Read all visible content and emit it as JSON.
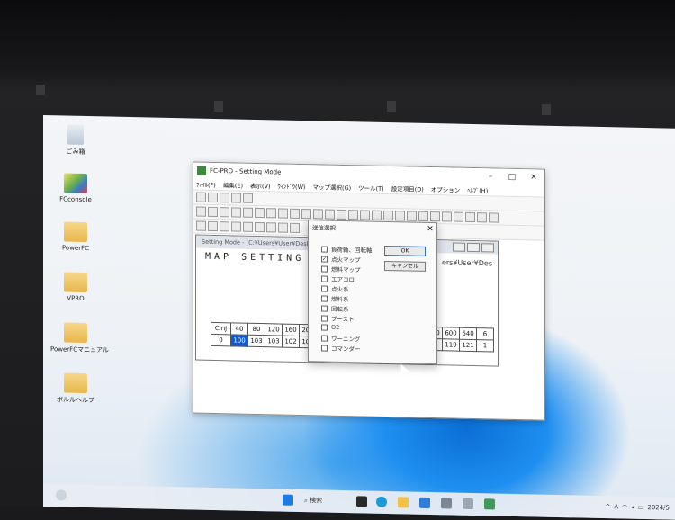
{
  "desktop": {
    "icons": [
      {
        "label": "ごみ箱",
        "kind": "bin"
      },
      {
        "label": "FCconsole",
        "kind": "app"
      },
      {
        "label": "PowerFC",
        "kind": "folder"
      },
      {
        "label": "VPRO",
        "kind": "folder"
      },
      {
        "label": "PowerFCマニュアル",
        "kind": "folder"
      },
      {
        "label": "ボルルヘルプ",
        "kind": "folder"
      }
    ]
  },
  "app": {
    "title": "FC-PRO - Setting Mode",
    "menu": [
      "ﾌｧｲﾙ(F)",
      "編集(E)",
      "表示(V)",
      "ｳｨﾝﾄﾞｳ(W)",
      "マップ選択(G)",
      "ツール(T)",
      "設定項目(D)",
      "オプション",
      "ﾍﾙﾌﾟ(H)"
    ],
    "child": {
      "title": "Setting Mode - [C:¥Users¥User¥Deskt",
      "header": "MAP SETTING M",
      "path": "ers¥User¥Des",
      "grid_header": [
        "Cinj",
        "40",
        "80",
        "120",
        "160",
        "200"
      ],
      "grid_row": [
        "0",
        "100",
        "103",
        "103",
        "102",
        "102"
      ],
      "grid2_header": [
        "560",
        "600",
        "640",
        "6"
      ],
      "grid2_row": [
        "18",
        "119",
        "121",
        "1"
      ]
    }
  },
  "dialog": {
    "title": "送信選択",
    "ok": "OK",
    "cancel": "キャンセル",
    "options": [
      {
        "label": "負荷軸、回転軸",
        "checked": false
      },
      {
        "label": "点火マップ",
        "checked": true
      },
      {
        "label": "燃料マップ",
        "checked": false
      },
      {
        "label": "エアコロ",
        "checked": false
      },
      {
        "label": "点火系",
        "checked": false
      },
      {
        "label": "燃料系",
        "checked": false
      },
      {
        "label": "回転系",
        "checked": false
      },
      {
        "label": "ブースト",
        "checked": false
      },
      {
        "label": "O2",
        "checked": false
      },
      {
        "label": "ワーニング",
        "checked": false
      },
      {
        "label": "コマンダー",
        "checked": false
      }
    ]
  },
  "taskbar": {
    "search": "検索",
    "tray": [
      "A",
      "2024/5"
    ]
  },
  "colors": {
    "accent": "#0f5ad6",
    "wallpaper": "#1e8ff0"
  }
}
